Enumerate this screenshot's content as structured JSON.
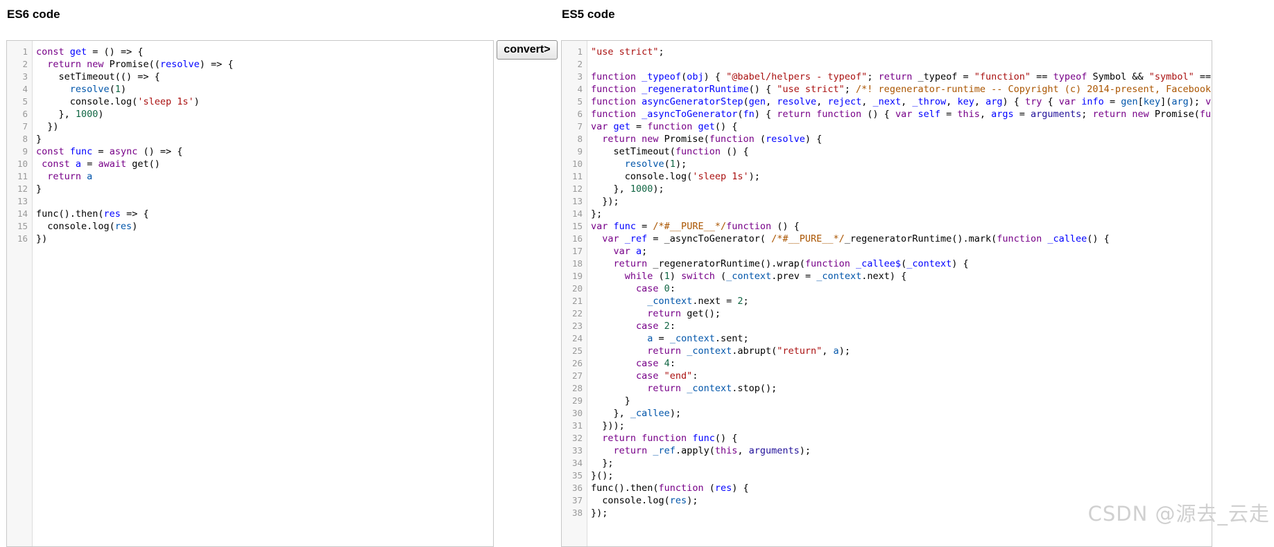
{
  "es6_title": "ES6 code",
  "es5_title": "ES5 code",
  "convert_label": "convert>",
  "watermark": "CSDN @源去_云走",
  "colors": {
    "keyword": "#770088",
    "definition": "#0000ff",
    "variable_2": "#0055aa",
    "string": "#aa1111",
    "number": "#116644",
    "comment": "#aa5500",
    "atom": "#221199"
  },
  "es6_lines": [
    [
      [
        "kw",
        "const "
      ],
      [
        "def",
        "get"
      ],
      [
        "p",
        " = () => {"
      ]
    ],
    [
      [
        "p",
        "  "
      ],
      [
        "kw",
        "return new "
      ],
      [
        "p",
        "Promise(("
      ],
      [
        "def",
        "resolve"
      ],
      [
        "p",
        ") => {"
      ]
    ],
    [
      [
        "p",
        "    setTimeout(() => {"
      ]
    ],
    [
      [
        "p",
        "      "
      ],
      [
        "var2",
        "resolve"
      ],
      [
        "p",
        "("
      ],
      [
        "num",
        "1"
      ],
      [
        "p",
        ")"
      ]
    ],
    [
      [
        "p",
        "      console.log("
      ],
      [
        "str",
        "'sleep 1s'"
      ],
      [
        "p",
        ")"
      ]
    ],
    [
      [
        "p",
        "    }, "
      ],
      [
        "num",
        "1000"
      ],
      [
        "p",
        ")"
      ]
    ],
    [
      [
        "p",
        "  })"
      ]
    ],
    [
      [
        "p",
        "}"
      ]
    ],
    [
      [
        "kw",
        "const "
      ],
      [
        "def",
        "func"
      ],
      [
        "p",
        " = "
      ],
      [
        "kw",
        "async"
      ],
      [
        "p",
        " () => {"
      ]
    ],
    [
      [
        "p",
        " "
      ],
      [
        "kw",
        "const "
      ],
      [
        "def",
        "a"
      ],
      [
        "p",
        " = "
      ],
      [
        "kw",
        "await "
      ],
      [
        "p",
        "get()"
      ]
    ],
    [
      [
        "p",
        "  "
      ],
      [
        "kw",
        "return "
      ],
      [
        "var2",
        "a"
      ]
    ],
    [
      [
        "p",
        "}"
      ]
    ],
    [],
    [
      [
        "p",
        "func().then("
      ],
      [
        "def",
        "res"
      ],
      [
        "p",
        " => {"
      ]
    ],
    [
      [
        "p",
        "  console.log("
      ],
      [
        "var2",
        "res"
      ],
      [
        "p",
        ")"
      ]
    ],
    [
      [
        "p",
        "})"
      ]
    ]
  ],
  "es5_lines": [
    [
      [
        "str",
        "\"use strict\""
      ],
      [
        "p",
        ";"
      ]
    ],
    [],
    [
      [
        "kw",
        "function "
      ],
      [
        "def",
        "_typeof"
      ],
      [
        "p",
        "("
      ],
      [
        "def",
        "obj"
      ],
      [
        "p",
        ") { "
      ],
      [
        "str",
        "\"@babel/helpers - typeof\""
      ],
      [
        "p",
        "; "
      ],
      [
        "kw",
        "return "
      ],
      [
        "p",
        "_typeof = "
      ],
      [
        "str",
        "\"function\""
      ],
      [
        "p",
        " == "
      ],
      [
        "kw",
        "typeof "
      ],
      [
        "p",
        "Symbol && "
      ],
      [
        "str",
        "\"symbol\""
      ],
      [
        "p",
        " == t"
      ]
    ],
    [
      [
        "kw",
        "function "
      ],
      [
        "def",
        "_regeneratorRuntime"
      ],
      [
        "p",
        "() { "
      ],
      [
        "str",
        "\"use strict\""
      ],
      [
        "p",
        "; "
      ],
      [
        "cmt",
        "/*! regenerator-runtime -- Copyright (c) 2014-present, Facebook,"
      ]
    ],
    [
      [
        "kw",
        "function "
      ],
      [
        "def",
        "asyncGeneratorStep"
      ],
      [
        "p",
        "("
      ],
      [
        "def",
        "gen"
      ],
      [
        "p",
        ", "
      ],
      [
        "def",
        "resolve"
      ],
      [
        "p",
        ", "
      ],
      [
        "def",
        "reject"
      ],
      [
        "p",
        ", "
      ],
      [
        "def",
        "_next"
      ],
      [
        "p",
        ", "
      ],
      [
        "def",
        "_throw"
      ],
      [
        "p",
        ", "
      ],
      [
        "def",
        "key"
      ],
      [
        "p",
        ", "
      ],
      [
        "def",
        "arg"
      ],
      [
        "p",
        ") { "
      ],
      [
        "kw",
        "try"
      ],
      [
        "p",
        " { "
      ],
      [
        "kw",
        "var "
      ],
      [
        "def",
        "info"
      ],
      [
        "p",
        " = "
      ],
      [
        "var2",
        "gen"
      ],
      [
        "p",
        "["
      ],
      [
        "var2",
        "key"
      ],
      [
        "p",
        "]("
      ],
      [
        "var2",
        "arg"
      ],
      [
        "p",
        "); "
      ],
      [
        "kw",
        "var"
      ]
    ],
    [
      [
        "kw",
        "function "
      ],
      [
        "def",
        "_asyncToGenerator"
      ],
      [
        "p",
        "("
      ],
      [
        "def",
        "fn"
      ],
      [
        "p",
        ") { "
      ],
      [
        "kw",
        "return function "
      ],
      [
        "p",
        "() { "
      ],
      [
        "kw",
        "var "
      ],
      [
        "def",
        "self"
      ],
      [
        "p",
        " = "
      ],
      [
        "kw",
        "this"
      ],
      [
        "p",
        ", "
      ],
      [
        "def",
        "args"
      ],
      [
        "p",
        " = "
      ],
      [
        "atom",
        "arguments"
      ],
      [
        "p",
        "; "
      ],
      [
        "kw",
        "return new "
      ],
      [
        "p",
        "Promise("
      ],
      [
        "kw",
        "func"
      ]
    ],
    [
      [
        "kw",
        "var "
      ],
      [
        "def",
        "get"
      ],
      [
        "p",
        " = "
      ],
      [
        "kw",
        "function "
      ],
      [
        "def",
        "get"
      ],
      [
        "p",
        "() {"
      ]
    ],
    [
      [
        "p",
        "  "
      ],
      [
        "kw",
        "return new "
      ],
      [
        "p",
        "Promise("
      ],
      [
        "kw",
        "function "
      ],
      [
        "p",
        "("
      ],
      [
        "def",
        "resolve"
      ],
      [
        "p",
        ") {"
      ]
    ],
    [
      [
        "p",
        "    setTimeout("
      ],
      [
        "kw",
        "function "
      ],
      [
        "p",
        "() {"
      ]
    ],
    [
      [
        "p",
        "      "
      ],
      [
        "var2",
        "resolve"
      ],
      [
        "p",
        "("
      ],
      [
        "num",
        "1"
      ],
      [
        "p",
        ");"
      ]
    ],
    [
      [
        "p",
        "      console.log("
      ],
      [
        "str",
        "'sleep 1s'"
      ],
      [
        "p",
        ");"
      ]
    ],
    [
      [
        "p",
        "    }, "
      ],
      [
        "num",
        "1000"
      ],
      [
        "p",
        ");"
      ]
    ],
    [
      [
        "p",
        "  });"
      ]
    ],
    [
      [
        "p",
        "};"
      ]
    ],
    [
      [
        "kw",
        "var "
      ],
      [
        "def",
        "func"
      ],
      [
        "p",
        " = "
      ],
      [
        "cmt",
        "/*#__PURE__*/"
      ],
      [
        "kw",
        "function "
      ],
      [
        "p",
        "() {"
      ]
    ],
    [
      [
        "p",
        "  "
      ],
      [
        "kw",
        "var "
      ],
      [
        "def",
        "_ref"
      ],
      [
        "p",
        " = _asyncToGenerator( "
      ],
      [
        "cmt",
        "/*#__PURE__*/"
      ],
      [
        "p",
        "_regeneratorRuntime().mark("
      ],
      [
        "kw",
        "function "
      ],
      [
        "def",
        "_callee"
      ],
      [
        "p",
        "() {"
      ]
    ],
    [
      [
        "p",
        "    "
      ],
      [
        "kw",
        "var "
      ],
      [
        "def",
        "a"
      ],
      [
        "p",
        ";"
      ]
    ],
    [
      [
        "p",
        "    "
      ],
      [
        "kw",
        "return "
      ],
      [
        "p",
        "_regeneratorRuntime().wrap("
      ],
      [
        "kw",
        "function "
      ],
      [
        "def",
        "_callee$"
      ],
      [
        "p",
        "("
      ],
      [
        "def",
        "_context"
      ],
      [
        "p",
        ") {"
      ]
    ],
    [
      [
        "p",
        "      "
      ],
      [
        "kw",
        "while "
      ],
      [
        "p",
        "("
      ],
      [
        "num",
        "1"
      ],
      [
        "p",
        ") "
      ],
      [
        "kw",
        "switch "
      ],
      [
        "p",
        "("
      ],
      [
        "var2",
        "_context"
      ],
      [
        "p",
        ".prev = "
      ],
      [
        "var2",
        "_context"
      ],
      [
        "p",
        ".next) {"
      ]
    ],
    [
      [
        "p",
        "        "
      ],
      [
        "kw",
        "case "
      ],
      [
        "num",
        "0"
      ],
      [
        "p",
        ":"
      ]
    ],
    [
      [
        "p",
        "          "
      ],
      [
        "var2",
        "_context"
      ],
      [
        "p",
        ".next = "
      ],
      [
        "num",
        "2"
      ],
      [
        "p",
        ";"
      ]
    ],
    [
      [
        "p",
        "          "
      ],
      [
        "kw",
        "return "
      ],
      [
        "p",
        "get();"
      ]
    ],
    [
      [
        "p",
        "        "
      ],
      [
        "kw",
        "case "
      ],
      [
        "num",
        "2"
      ],
      [
        "p",
        ":"
      ]
    ],
    [
      [
        "p",
        "          "
      ],
      [
        "var2",
        "a"
      ],
      [
        "p",
        " = "
      ],
      [
        "var2",
        "_context"
      ],
      [
        "p",
        ".sent;"
      ]
    ],
    [
      [
        "p",
        "          "
      ],
      [
        "kw",
        "return "
      ],
      [
        "var2",
        "_context"
      ],
      [
        "p",
        ".abrupt("
      ],
      [
        "str",
        "\"return\""
      ],
      [
        "p",
        ", "
      ],
      [
        "var2",
        "a"
      ],
      [
        "p",
        ");"
      ]
    ],
    [
      [
        "p",
        "        "
      ],
      [
        "kw",
        "case "
      ],
      [
        "num",
        "4"
      ],
      [
        "p",
        ":"
      ]
    ],
    [
      [
        "p",
        "        "
      ],
      [
        "kw",
        "case "
      ],
      [
        "str",
        "\"end\""
      ],
      [
        "p",
        ":"
      ]
    ],
    [
      [
        "p",
        "          "
      ],
      [
        "kw",
        "return "
      ],
      [
        "var2",
        "_context"
      ],
      [
        "p",
        ".stop();"
      ]
    ],
    [
      [
        "p",
        "      }"
      ]
    ],
    [
      [
        "p",
        "    }, "
      ],
      [
        "var2",
        "_callee"
      ],
      [
        "p",
        ");"
      ]
    ],
    [
      [
        "p",
        "  }));"
      ]
    ],
    [
      [
        "p",
        "  "
      ],
      [
        "kw",
        "return function "
      ],
      [
        "def",
        "func"
      ],
      [
        "p",
        "() {"
      ]
    ],
    [
      [
        "p",
        "    "
      ],
      [
        "kw",
        "return "
      ],
      [
        "var2",
        "_ref"
      ],
      [
        "p",
        ".apply("
      ],
      [
        "kw",
        "this"
      ],
      [
        "p",
        ", "
      ],
      [
        "atom",
        "arguments"
      ],
      [
        "p",
        ");"
      ]
    ],
    [
      [
        "p",
        "  };"
      ]
    ],
    [
      [
        "p",
        "}();"
      ]
    ],
    [
      [
        "p",
        "func().then("
      ],
      [
        "kw",
        "function "
      ],
      [
        "p",
        "("
      ],
      [
        "def",
        "res"
      ],
      [
        "p",
        ") {"
      ]
    ],
    [
      [
        "p",
        "  console.log("
      ],
      [
        "var2",
        "res"
      ],
      [
        "p",
        ");"
      ]
    ],
    [
      [
        "p",
        "});"
      ]
    ]
  ]
}
